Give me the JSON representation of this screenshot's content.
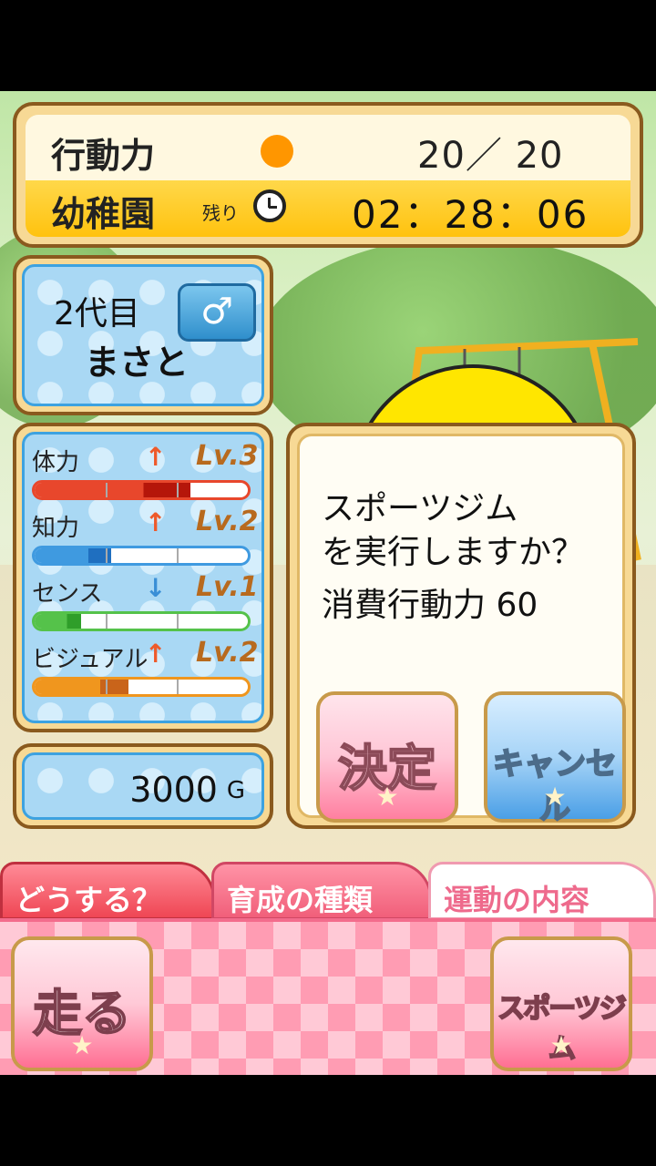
{
  "status": {
    "action_points_label": "行動力",
    "action_points_value": "20／ 20",
    "stage_label": "幼稚園",
    "remaining_label": "残り",
    "timer": "02：28：06"
  },
  "character": {
    "generation": "2代目",
    "gender_symbol": "♂",
    "name": "まさと"
  },
  "stats": [
    {
      "name": "体力",
      "trend": "↑",
      "level": "Lv.3",
      "progress": 0.73,
      "bar_color": "#e8472c",
      "fill_color": "#b5160a",
      "arrow_color": "#ee5a2a"
    },
    {
      "name": "知力",
      "trend": "↑",
      "level": "Lv.2",
      "progress": 0.36,
      "bar_color": "#3f9ae0",
      "fill_color": "#1f6fc0",
      "arrow_color": "#ee5a2a"
    },
    {
      "name": "センス",
      "trend": "↓",
      "level": "Lv.1",
      "progress": 0.22,
      "bar_color": "#55c24a",
      "fill_color": "#2f9e2a",
      "arrow_color": "#3a8fd6"
    },
    {
      "name": "ビジュアル",
      "trend": "↑",
      "level": "Lv.2",
      "progress": 0.44,
      "bar_color": "#f0961e",
      "fill_color": "#c9641a",
      "arrow_color": "#ee5a2a"
    }
  ],
  "money": {
    "value": "3000",
    "unit": "G"
  },
  "dialog": {
    "line1": "スポーツジム",
    "line2": "を実行しますか？",
    "cost": "消費行動力  60",
    "confirm_label": "決定",
    "cancel_label": "キャンセル"
  },
  "tabs": [
    {
      "label": "どうする？"
    },
    {
      "label": "育成の種類"
    },
    {
      "label": "運動の内容"
    }
  ],
  "actions": {
    "run_label": "走る",
    "gym_label": "スポーツジム"
  },
  "colors": {
    "accent_gold": "#f7d995",
    "frame_brown": "#8a5a1e",
    "ap_dot": "#ff9600",
    "pink": "#ff9cb3",
    "blue_panel": "#a9d8f4"
  }
}
